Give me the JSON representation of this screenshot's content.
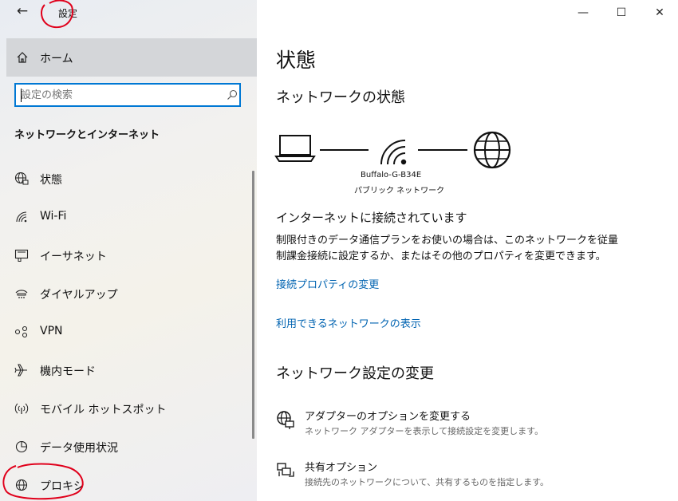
{
  "window": {
    "title": "設定",
    "minimize_glyph": "—",
    "maximize_glyph": "☐",
    "close_glyph": "✕"
  },
  "sidebar": {
    "home_label": "ホーム",
    "search_placeholder": "設定の検索",
    "section_heading": "ネットワークとインターネット",
    "items": [
      {
        "label": "状態",
        "icon": "globe-status-icon"
      },
      {
        "label": "Wi-Fi",
        "icon": "wifi-icon"
      },
      {
        "label": "イーサネット",
        "icon": "ethernet-icon"
      },
      {
        "label": "ダイヤルアップ",
        "icon": "dialup-icon"
      },
      {
        "label": "VPN",
        "icon": "vpn-icon"
      },
      {
        "label": "機内モード",
        "icon": "airplane-icon"
      },
      {
        "label": "モバイル ホットスポット",
        "icon": "hotspot-icon"
      },
      {
        "label": "データ使用状況",
        "icon": "data-usage-icon"
      },
      {
        "label": "プロキシ",
        "icon": "proxy-globe-icon"
      }
    ]
  },
  "main": {
    "page_title": "状態",
    "network_status_heading": "ネットワークの状態",
    "ssid": "Buffalo-G-B34E",
    "network_type": "パブリック ネットワーク",
    "connected_heading": "インターネットに接続されています",
    "description_lines": [
      "制限付きのデータ通信プランをお使いの場合は、このネットワークを従量",
      "制課金接続に設定するか、またはその他のプロパティを変更できます。"
    ],
    "link_properties": "接続プロパティの変更",
    "link_available_networks": "利用できるネットワークの表示",
    "change_settings_heading": "ネットワーク設定の変更",
    "options": [
      {
        "title": "アダプターのオプションを変更する",
        "description": "ネットワーク アダプターを表示して接続設定を変更します。",
        "icon": "adapter-icon"
      },
      {
        "title": "共有オプション",
        "description": "接続先のネットワークについて、共有するものを指定します。",
        "icon": "sharing-icon"
      }
    ]
  },
  "colors": {
    "accent": "#0078d4",
    "link": "#0063b1",
    "annotation": "#e0001b"
  }
}
